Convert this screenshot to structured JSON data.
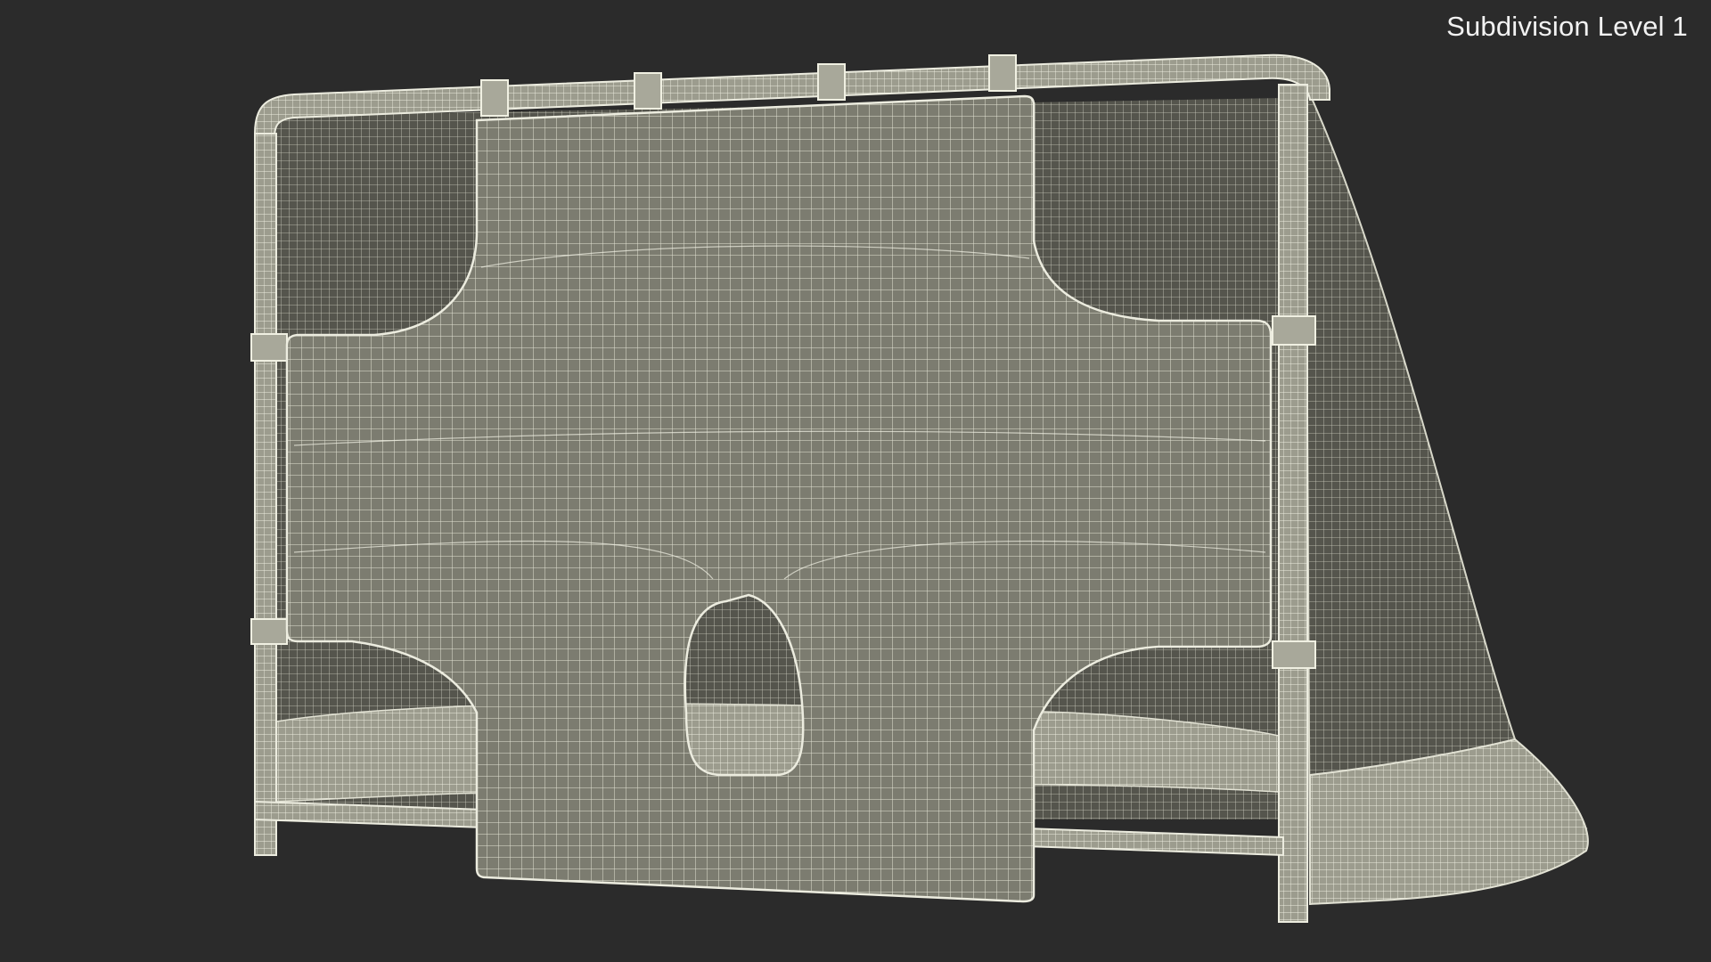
{
  "overlay": {
    "subdivision_label": "Subdivision Level 1"
  },
  "scene": {
    "object": "soccer-goal-with-target-training-sheet",
    "display_mode": "wireframe-on-shaded",
    "colors": {
      "background": "#2b2b2b",
      "surface": "#7c7c70",
      "surface_dark": "#5f5f56",
      "frame": "#b4b4a6",
      "wire": "#e8e8da"
    }
  }
}
